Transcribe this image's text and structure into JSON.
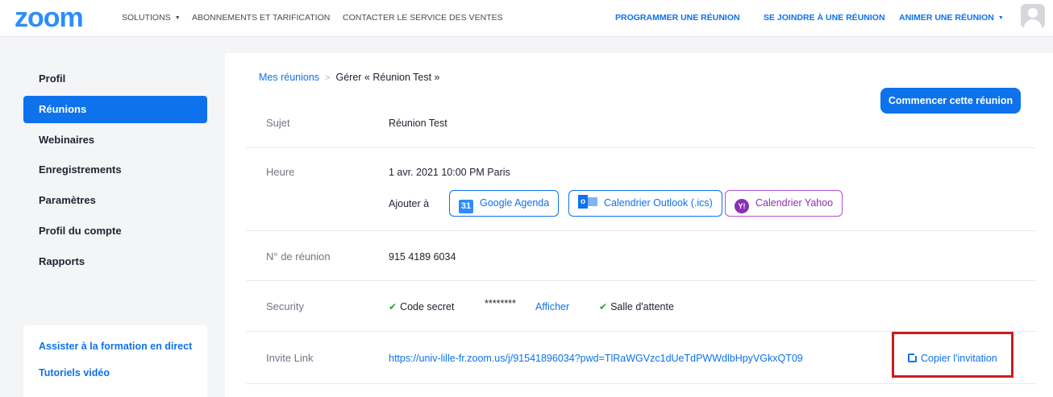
{
  "nav": {
    "logo": "zoom",
    "solutions": "SOLUTIONS",
    "pricing": "ABONNEMENTS ET TARIFICATION",
    "contact": "CONTACTER LE SERVICE DES VENTES",
    "schedule": "PROGRAMMER UNE RÉUNION",
    "join": "SE JOINDRE À UNE RÉUNION",
    "host": "ANIMER UNE RÉUNION"
  },
  "sidebar": {
    "items": [
      {
        "label": "Profil"
      },
      {
        "label": "Réunions"
      },
      {
        "label": "Webinaires"
      },
      {
        "label": "Enregistrements"
      },
      {
        "label": "Paramètres"
      },
      {
        "label": "Profil du compte"
      },
      {
        "label": "Rapports"
      }
    ],
    "links": [
      "Assister à la formation en direct",
      "Tutoriels vidéo"
    ]
  },
  "breadcrumb": {
    "parent": "Mes réunions",
    "separator": ">",
    "current": "Gérer « Réunion Test »"
  },
  "main": {
    "start_button": "Commencer cette réunion",
    "topic_label": "Sujet",
    "topic_value": "Réunion Test",
    "time_label": "Heure",
    "time_value": "1 avr. 2021 10:00 PM Paris",
    "add_to": "Ajouter à",
    "google": "Google Agenda",
    "google_icon": "31",
    "outlook": "Calendrier Outlook (.ics)",
    "outlook_icon": "o",
    "yahoo": "Calendrier Yahoo",
    "yahoo_icon": "Y!",
    "meeting_id_label": "N° de réunion",
    "meeting_id_value": "915 4189 6034",
    "security_label": "Security",
    "passcode_label": "Code secret",
    "passcode_value": "********",
    "show_link": "Afficher",
    "waiting_room": "Salle d'attente",
    "invite_label": "Invite Link",
    "invite_url": "https://univ-lille-fr.zoom.us/j/91541896034?pwd=TlRaWGVzc1dUeTdPWWdlbHpyVGkxQT09",
    "copy_invite": "Copier l'invitation"
  },
  "colors": {
    "brand": "#2D8CFF",
    "primary": "#0E72ED",
    "highlight": "#c81e1e"
  }
}
